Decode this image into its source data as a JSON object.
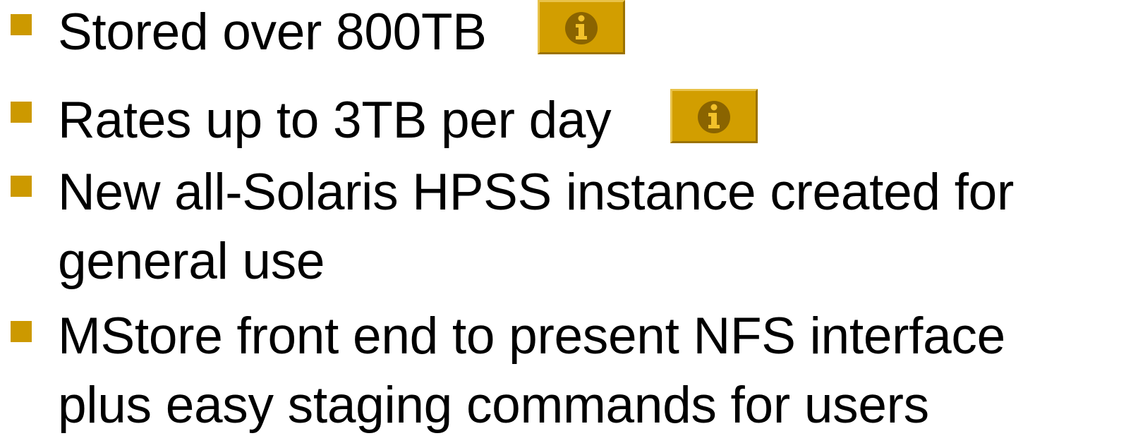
{
  "colors": {
    "bullet": "#cc9900",
    "info_button": "#d29e00",
    "info_icon_circle": "#8a6400",
    "info_icon_glyph": "#f2c12a",
    "text": "#000000",
    "background": "#ffffff"
  },
  "bullets": [
    {
      "lines": [
        "Stored over 800TB"
      ],
      "info_icon": "info-icon"
    },
    {
      "lines": [
        "Rates up to 3TB per day"
      ],
      "info_icon": "info-icon"
    },
    {
      "lines": [
        "New all-Solaris HPSS instance created for",
        "general use"
      ]
    },
    {
      "lines": [
        "MStore front end to present NFS interface",
        "plus easy staging commands for users"
      ]
    }
  ]
}
